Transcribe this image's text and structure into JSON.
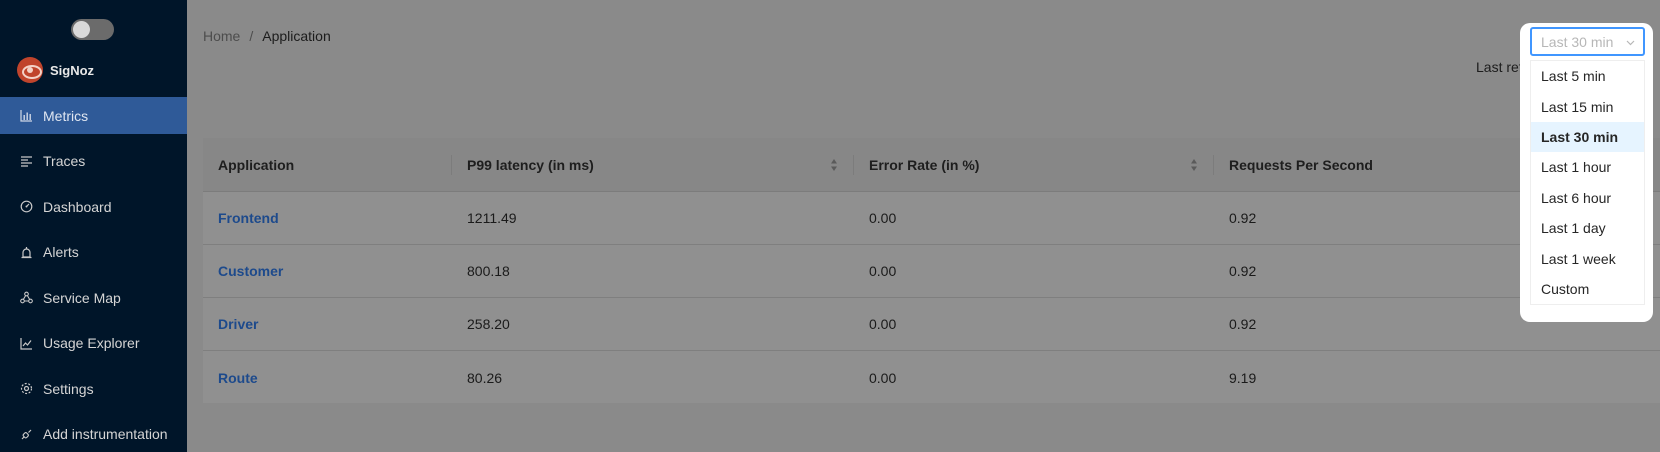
{
  "brand": {
    "name": "SigNoz"
  },
  "sidebar": {
    "items": [
      {
        "label": "Metrics",
        "icon": "bar-chart-icon",
        "active": true
      },
      {
        "label": "Traces",
        "icon": "align-left-icon",
        "active": false
      },
      {
        "label": "Dashboard",
        "icon": "dashboard-icon",
        "active": false
      },
      {
        "label": "Alerts",
        "icon": "alarm-icon",
        "active": false
      },
      {
        "label": "Service Map",
        "icon": "deployment-unit-icon",
        "active": false
      },
      {
        "label": "Usage Explorer",
        "icon": "line-chart-icon",
        "active": false
      },
      {
        "label": "Settings",
        "icon": "gear-icon",
        "active": false
      },
      {
        "label": "Add instrumentation",
        "icon": "api-icon",
        "active": false
      }
    ]
  },
  "breadcrumb": {
    "home": "Home",
    "separator": "/",
    "current": "Application"
  },
  "last_refresh": "Last refr",
  "table": {
    "columns": [
      "Application",
      "P99 latency (in ms)",
      "Error Rate (in %)",
      "Requests Per Second"
    ],
    "rows": [
      [
        "Frontend",
        "1211.49",
        "0.00",
        "0.92"
      ],
      [
        "Customer",
        "800.18",
        "0.00",
        "0.92"
      ],
      [
        "Driver",
        "258.20",
        "0.00",
        "0.92"
      ],
      [
        "Route",
        "80.26",
        "0.00",
        "9.19"
      ]
    ]
  },
  "time_picker": {
    "selected": "Last 30 min",
    "options": [
      "Last 5 min",
      "Last 15 min",
      "Last 30 min",
      "Last 1 hour",
      "Last 6 hour",
      "Last 1 day",
      "Last 1 week",
      "Custom"
    ]
  },
  "colors": {
    "sidebar_bg": "#001529",
    "active_item": "#2f5a98",
    "link": "#1d4a8c",
    "focus": "#4096ff"
  }
}
